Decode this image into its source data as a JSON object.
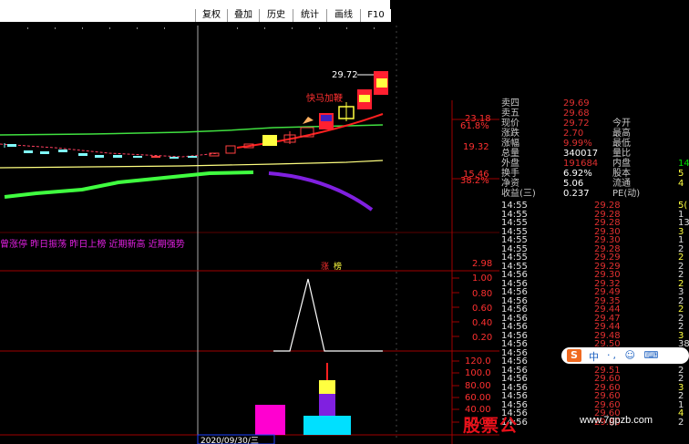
{
  "toolbar": {
    "buttons": [
      "复权",
      "叠加",
      "历史",
      "统计",
      "画线",
      "F10"
    ]
  },
  "chart": {
    "price_high_label": "29.72",
    "annotation_label": "快马加鞭",
    "right_axis": {
      "top_value": "23.18",
      "top_pct": "61.8%",
      "mid_value": "19.32",
      "low_value": "15.46",
      "low_pct": "38.2%"
    },
    "signal_legend": "曾涨停 昨日振荡 昨日上榜 近期新高 近期强势",
    "signal_tags": [
      "涨",
      "榜"
    ],
    "ind1_axis": [
      "2.98",
      "1.00",
      "0.80",
      "0.60",
      "0.40",
      "0.20"
    ],
    "ind2_axis": [
      "120.0",
      "100.0",
      "80.00",
      "60.00",
      "40.00",
      "20.00"
    ],
    "date_label": "2020/09/30/三",
    "colors": {
      "up": "#ff2020",
      "bar_yellow": "#ffff40",
      "bar_red": "#ff2030",
      "ma_green": "#40ff40",
      "ma_purple": "#8020e0",
      "ma_yellow": "#ffff80",
      "ma_magenta": "#ff00a0"
    }
  },
  "quote": {
    "rows": [
      {
        "label": "卖四",
        "value": "29.69",
        "label2": "",
        "value2": ""
      },
      {
        "label": "卖五",
        "value": "29.68",
        "label2": "",
        "value2": ""
      },
      {
        "label": "现价",
        "value": "29.72",
        "label2": "今开",
        "value2": ""
      },
      {
        "label": "涨跌",
        "value": "2.70",
        "label2": "最高",
        "value2": ""
      },
      {
        "label": "涨幅",
        "value": "9.99%",
        "label2": "最低",
        "value2": ""
      },
      {
        "label": "总量",
        "value": "340017",
        "label2": "量比",
        "value2": ""
      },
      {
        "label": "外盘",
        "value": "191684",
        "label2": "内盘",
        "value2": "14"
      },
      {
        "label": "换手",
        "value": "6.92%",
        "label2": "股本",
        "value2": "5"
      },
      {
        "label": "净资",
        "value": "5.06",
        "label2": "流通",
        "value2": "4"
      },
      {
        "label": "收益(三)",
        "value": "0.237",
        "label2": "PE(动)",
        "value2": ""
      }
    ],
    "ticks": [
      {
        "time": "14:55",
        "price": "29.28",
        "vol": "5("
      },
      {
        "time": "14:55",
        "price": "29.28",
        "vol": "1"
      },
      {
        "time": "14:55",
        "price": "29.28",
        "vol": "13"
      },
      {
        "time": "14:55",
        "price": "29.30",
        "vol": "3"
      },
      {
        "time": "14:55",
        "price": "29.30",
        "vol": "1"
      },
      {
        "time": "14:55",
        "price": "29.28",
        "vol": "2"
      },
      {
        "time": "14:55",
        "price": "29.29",
        "vol": "2"
      },
      {
        "time": "14:55",
        "price": "29.29",
        "vol": "2"
      },
      {
        "time": "14:56",
        "price": "29.30",
        "vol": "2"
      },
      {
        "time": "14:56",
        "price": "29.32",
        "vol": "2"
      },
      {
        "time": "14:56",
        "price": "29.49",
        "vol": "3"
      },
      {
        "time": "14:56",
        "price": "29.35",
        "vol": "2"
      },
      {
        "time": "14:56",
        "price": "29.44",
        "vol": "2"
      },
      {
        "time": "14:56",
        "price": "29.47",
        "vol": "2"
      },
      {
        "time": "14:56",
        "price": "29.44",
        "vol": "2"
      },
      {
        "time": "14:56",
        "price": "29.48",
        "vol": "3"
      },
      {
        "time": "14:56",
        "price": "29.50",
        "vol": "38"
      },
      {
        "time": "14:56",
        "price": "29.50",
        "vol": "5"
      },
      {
        "time": "14:56",
        "price": "29.52",
        "vol": "3"
      },
      {
        "time": "14:56",
        "price": "29.51",
        "vol": "2"
      },
      {
        "time": "14:56",
        "price": "29.60",
        "vol": "2"
      },
      {
        "time": "14:56",
        "price": "29.60",
        "vol": "3"
      },
      {
        "time": "14:56",
        "price": "29.60",
        "vol": "2"
      },
      {
        "time": "14:56",
        "price": "29.60",
        "vol": "1"
      },
      {
        "time": "14:56",
        "price": "29.60",
        "vol": "4"
      },
      {
        "time": "14:56",
        "price": "29.60",
        "vol": "2"
      }
    ]
  },
  "watermark": {
    "logo_text": "股票公",
    "url": "www.7gpzb.com"
  },
  "sogou": {
    "s": "S",
    "zh": "中",
    "dots": "·, ☺ ⌨"
  }
}
